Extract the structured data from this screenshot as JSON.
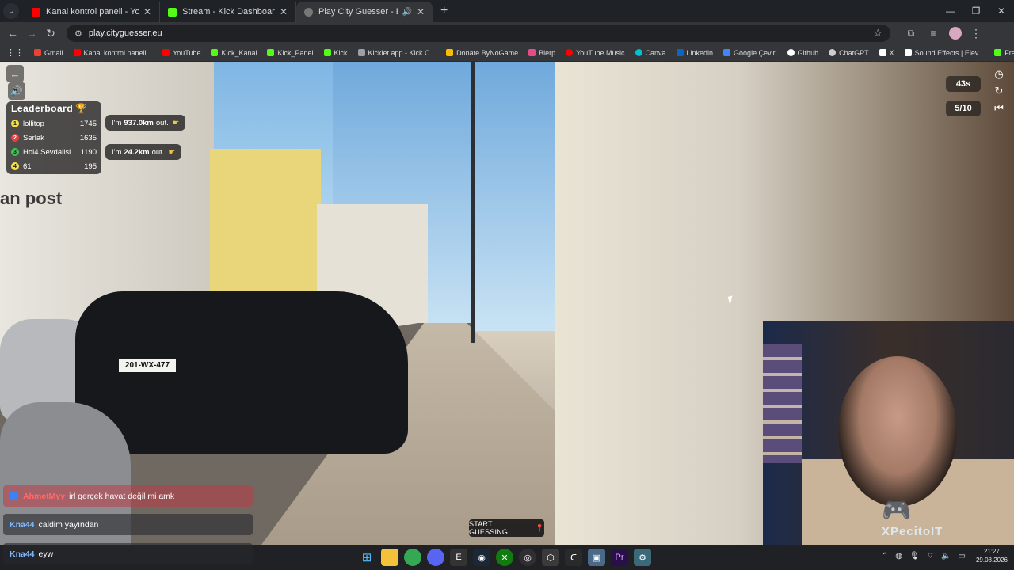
{
  "browser": {
    "tabs": [
      {
        "title": "Kanal kontrol paneli - YouTube",
        "favicon_color": "#ff0000",
        "active": false
      },
      {
        "title": "Stream - Kick Dashboard",
        "favicon_color": "#53fc18",
        "active": false
      },
      {
        "title": "Play City Guesser - Explore",
        "favicon_color": "#777777",
        "active": true
      }
    ],
    "new_tab": "+",
    "url": "play.cityguesser.eu",
    "window_controls": [
      "—",
      "❐",
      "✕"
    ]
  },
  "bookmarks": [
    {
      "label": "Gmail",
      "color": "#ea4335"
    },
    {
      "label": "Kanal kontrol paneli...",
      "color": "#ff0000"
    },
    {
      "label": "YouTube",
      "color": "#ff0000"
    },
    {
      "label": "Kick_Kanal",
      "color": "#53fc18"
    },
    {
      "label": "Kick_Panel",
      "color": "#53fc18"
    },
    {
      "label": "Kick",
      "color": "#53fc18"
    },
    {
      "label": "Kicklet.app - Kick C...",
      "color": "#9aa0a6"
    },
    {
      "label": "Donate ByNoGame",
      "color": "#fbbc04"
    },
    {
      "label": "Blerp",
      "color": "#e84c88"
    },
    {
      "label": "YouTube Music",
      "color": "#ff0000"
    },
    {
      "label": "Canva",
      "color": "#00c4cc"
    },
    {
      "label": "Linkedin",
      "color": "#0a66c2"
    },
    {
      "label": "Google Çeviri",
      "color": "#4285f4"
    },
    {
      "label": "Github",
      "color": "#ffffff"
    },
    {
      "label": "ChatGPT",
      "color": "#cfcfcf"
    },
    {
      "label": "X",
      "color": "#ffffff"
    },
    {
      "label": "Sound Effects | Elev...",
      "color": "#ffffff"
    },
    {
      "label": "Free Turkish langua...",
      "color": "#53fc18"
    }
  ],
  "game": {
    "timer": "43s",
    "round": "5/10",
    "leaderboard_title": "Leaderboard",
    "leaderboard": [
      {
        "rank": "1",
        "name": "lollitop",
        "score": "1745",
        "color": "#f5e04a"
      },
      {
        "rank": "2",
        "name": "Serlak",
        "score": "1635",
        "color": "#e84040"
      },
      {
        "rank": "3",
        "name": "Hoi4 Sevdalisi",
        "score": "1190",
        "color": "#3fc35a"
      },
      {
        "rank": "4",
        "name": "61",
        "score": "195",
        "color": "#f5e04a"
      }
    ],
    "bubbles": [
      {
        "prefix": "I'm",
        "value": "937.0km",
        "suffix": "out."
      },
      {
        "prefix": "I'm",
        "value": "24.2km",
        "suffix": "out."
      }
    ],
    "plate": "201-WX-477",
    "shop_sign": "an post",
    "start_button": "START GUESSING"
  },
  "chat": [
    {
      "user": "AhmetMyy",
      "message": "irl gerçek hayat değil mi amk",
      "user_color": "#ff6b6b",
      "bg": "rgba(190,60,70,.55)"
    },
    {
      "user": "Kna44",
      "message": "caldim yayından",
      "user_color": "#7fb8ff",
      "bg": "rgba(40,40,45,.6)"
    },
    {
      "user": "Kna44",
      "message": "eyw",
      "user_color": "#7fb8ff",
      "bg": "rgba(40,40,45,.6)"
    }
  ],
  "stream_brand": "XPecitoIT",
  "taskbar": {
    "time": "21:27",
    "date": "29.08.2026"
  }
}
